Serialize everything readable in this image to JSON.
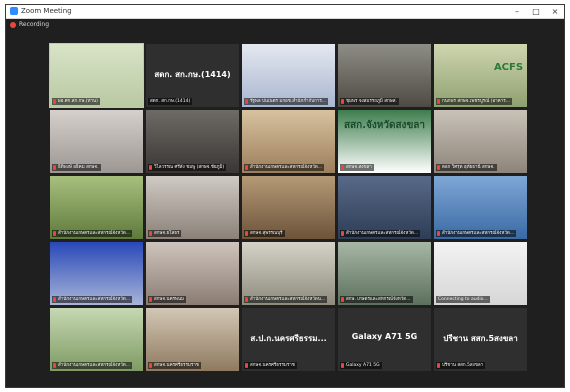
{
  "window": {
    "title": "Zoom Meeting",
    "controls": {
      "minimize": "–",
      "maximize": "□",
      "close": "×"
    }
  },
  "recording": {
    "label": "Recording"
  },
  "colors": {
    "background": "#1f1f1f",
    "active_speaker": "#e8d600",
    "mic_muted": "#e8473c",
    "zoom_blue": "#2d8cff"
  },
  "tiles": [
    {
      "name": "ผอ.ศก.สก.กษ.(ท่าน)",
      "screen_text": "",
      "muted": true,
      "active": true
    },
    {
      "name": "สดก. สก.กษ.(1414)",
      "screen_text": "สดก. สก.กษ.(1414)",
      "muted": false,
      "active": false
    },
    {
      "name": "รัฐพล ปนเนตร มกอช.สำนักกำกับการ...",
      "screen_text": "",
      "muted": true,
      "active": false
    },
    {
      "name": "ชุมพร จงสมรรถภูมิ สกษส.",
      "screen_text": "",
      "muted": true,
      "active": false
    },
    {
      "name": "กนกพร สกษจ.เพชรบูรณ์ (อาคาร...",
      "screen_text": "ACFS",
      "muted": true,
      "active": false
    },
    {
      "name": "ธิติพงษ์ อธิคม สกษจ.",
      "screen_text": "",
      "muted": true,
      "active": false
    },
    {
      "name": "วิไลวรรณ ศรีสัง ชมพู (สกษจ.ชัยภูมิ)",
      "screen_text": "",
      "muted": true,
      "active": false
    },
    {
      "name": "สำนักงานเกษตรและสหกรณ์จังหวัด...",
      "screen_text": "",
      "muted": true,
      "active": false
    },
    {
      "name": "สกษจ.สงขลา",
      "screen_text": "สสก.จังหวัดสงขลา",
      "muted": true,
      "active": false
    },
    {
      "name": "ตอก วิศรุต อุทัยธานี สกษจ.",
      "screen_text": "",
      "muted": true,
      "active": false
    },
    {
      "name": "สำนักงานเกษตรและสหกรณ์จังหวัด...",
      "screen_text": "",
      "muted": true,
      "active": false
    },
    {
      "name": "สกษจ.ยโสธร",
      "screen_text": "",
      "muted": true,
      "active": false
    },
    {
      "name": "สกษจ.สุพรรณบุรี",
      "screen_text": "",
      "muted": true,
      "active": false
    },
    {
      "name": "สำนักงานเกษตรและสหกรณ์จังหวัด...",
      "screen_text": "",
      "muted": true,
      "active": false
    },
    {
      "name": "สำนักงานเกษตรและสหกรณ์จังหวัด...",
      "screen_text": "",
      "muted": true,
      "active": false
    },
    {
      "name": "สำนักงานเกษตรและสหกรณ์จังหวัด...",
      "screen_text": "",
      "muted": true,
      "active": false
    },
    {
      "name": "สกษจ.นครพนม",
      "screen_text": "",
      "muted": true,
      "active": false
    },
    {
      "name": "สำนักงานเกษตรและสหกรณ์จังหวัดน...",
      "screen_text": "",
      "muted": true,
      "active": false
    },
    {
      "name": "สกษ. เกษตรและสหกรณ์จังหวัด...",
      "screen_text": "",
      "muted": true,
      "active": false
    },
    {
      "name": "Connecting to audio...",
      "screen_text": "",
      "muted": false,
      "active": false
    },
    {
      "name": "สำนักงานเกษตรและสหกรณ์จังหวัด...",
      "screen_text": "",
      "muted": true,
      "active": false
    },
    {
      "name": "สกษจ.นครศรีธรรมราช",
      "screen_text": "",
      "muted": true,
      "active": false
    },
    {
      "name": "สกษจ.นครศรีธรรมราช",
      "screen_text": "ส.ป.ก.นครศรีธรรม...",
      "muted": true,
      "active": false
    },
    {
      "name": "Galaxy A71 5G",
      "screen_text": "Galaxy A71 5G",
      "muted": true,
      "active": false
    },
    {
      "name": "ปรีชาน สสก.5สงขลา",
      "screen_text": "ปรีชาน สสก.5สงขลา",
      "muted": true,
      "active": false
    }
  ]
}
